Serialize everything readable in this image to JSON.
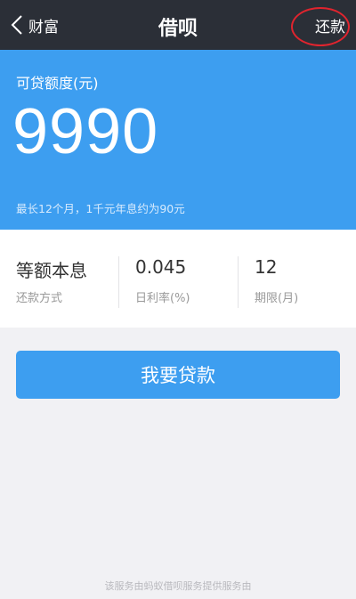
{
  "nav": {
    "back_label": "财富",
    "title": "借呗",
    "action_label": "还款"
  },
  "hero": {
    "label": "可贷额度(元)",
    "amount": "9990",
    "note": "最长12个月，1千元年息约为90元"
  },
  "stats": [
    {
      "value": "等额本息",
      "label": "还款方式"
    },
    {
      "value": "0.045",
      "label": "日利率(%)"
    },
    {
      "value": "12",
      "label": "期限(月)"
    }
  ],
  "loan_button": {
    "label": "我要贷款"
  },
  "footer": {
    "text": "该服务由蚂蚁借呗服务提供服务由"
  },
  "colors": {
    "navbar": "#2b2f37",
    "accent": "#3d9ef0",
    "highlight": "#e0242e"
  }
}
